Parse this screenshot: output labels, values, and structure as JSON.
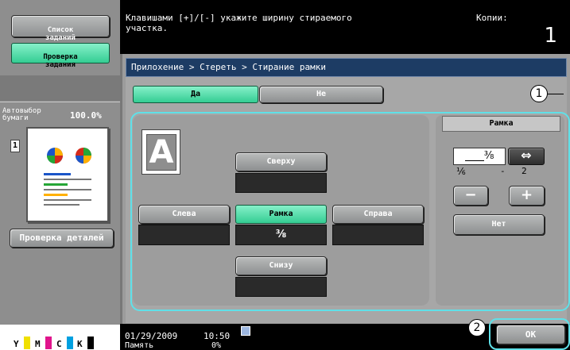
{
  "sidebar": {
    "job_list_label": "Список\nзаданий",
    "check_job_label": "Проверка\nзадания",
    "paper_auto_label": "Автовыбор\nбумаги",
    "zoom_value": "100.0%",
    "copies_index": "1",
    "check_details_label": "Проверка деталей",
    "toner": [
      {
        "label": "Y",
        "color": "#f0e000"
      },
      {
        "label": "M",
        "color": "#e0148c"
      },
      {
        "label": "C",
        "color": "#00a0e0"
      },
      {
        "label": "K",
        "color": "#000000"
      }
    ]
  },
  "header": {
    "message": "Клавишами [+]/[-] укажите ширину стираемого\nучастка.",
    "copies_label": "Копии:",
    "copies_value": "1"
  },
  "breadcrumb": "Прилохение > Стереть > Стирание рамки",
  "toggle": {
    "yes_label": "Да",
    "no_label": "Не",
    "callout_1": "1"
  },
  "positions": {
    "top_label": "Сверху",
    "top_value": "",
    "left_label": "Слева",
    "left_value": "",
    "frame_label": "Рамка",
    "frame_value": "⅜",
    "right_label": "Справа",
    "right_value": "",
    "bottom_label": "Снизу",
    "bottom_value": ""
  },
  "frame_panel": {
    "title": "Рамка",
    "value": "⅜",
    "min": "⅙",
    "dash": "-",
    "max": "2",
    "minus_label": "−",
    "plus_label": "+",
    "none_label": "Нет"
  },
  "footer": {
    "date": "01/29/2009",
    "time": "10:50",
    "memory_label": "Память",
    "memory_value": "0%",
    "callout_2": "2",
    "ok_label": "OK"
  }
}
